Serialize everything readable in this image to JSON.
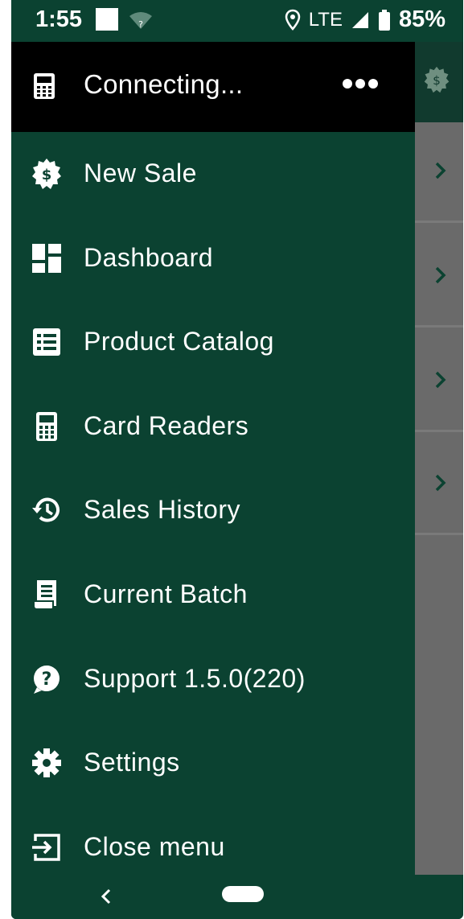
{
  "status_bar": {
    "time": "1:55",
    "network": "LTE",
    "battery": "85%"
  },
  "drawer": {
    "header_title": "Connecting...",
    "items": [
      {
        "label": "New Sale",
        "icon": "dollar-badge-icon"
      },
      {
        "label": "Dashboard",
        "icon": "dashboard-icon"
      },
      {
        "label": "Product Catalog",
        "icon": "list-icon"
      },
      {
        "label": "Card Readers",
        "icon": "calculator-icon"
      },
      {
        "label": "Sales History",
        "icon": "history-icon"
      },
      {
        "label": "Current Batch",
        "icon": "receipt-icon"
      },
      {
        "label": "Support 1.5.0(220)",
        "icon": "help-icon"
      },
      {
        "label": "Settings",
        "icon": "gear-icon"
      },
      {
        "label": "Close menu",
        "icon": "exit-icon"
      }
    ]
  },
  "colors": {
    "drawer_bg": "#0b4231",
    "header_bg": "#000000",
    "scrim": "#6a6a6a",
    "accent": "#0b4231",
    "text": "#ffffff"
  }
}
